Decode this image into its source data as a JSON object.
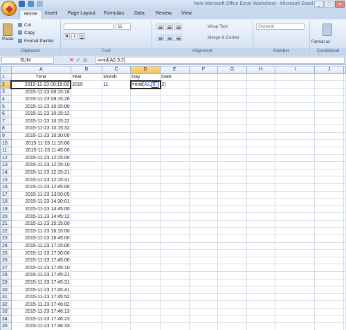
{
  "titlebar": {
    "title": "New Microsoft Office Excel Worksheet - Microsoft Excel",
    "office_button_icon": "office-button-icon",
    "qat_icons": [
      "save-icon",
      "undo-icon",
      "redo-icon"
    ],
    "window_controls": [
      "_",
      "□",
      "×"
    ]
  },
  "ribbon": {
    "tabs": [
      "Home",
      "Insert",
      "Page Layout",
      "Formulas",
      "Data",
      "Review",
      "View"
    ],
    "active_tab": "Home",
    "clipboard": {
      "paste": "Paste",
      "cut": "Cut",
      "copy": "Copy",
      "format_painter": "Format Painter",
      "label": "Clipboard"
    },
    "font": {
      "size": "11",
      "label": "Font",
      "bold": "B",
      "italic": "I",
      "underline": "U"
    },
    "alignment": {
      "wrap_text": "Wrap Text",
      "merge_center": "Merge & Center",
      "label": "Alignment"
    },
    "number": {
      "format": "General",
      "label": "Number"
    },
    "styles": {
      "conditional_formatting": "Conditional Formatting",
      "format_as": "Format as"
    }
  },
  "formula_bar": {
    "name_box": "SUM",
    "cancel": "✕",
    "enter": "✓",
    "fx": "fx",
    "formula": "=mid(A2,9,2)"
  },
  "sheet": {
    "columns": [
      "A",
      "B",
      "C",
      "D",
      "E",
      "F",
      "G",
      "H",
      "I",
      "J"
    ],
    "active_column": "D",
    "active_row": "2",
    "headers": {
      "A": "Time",
      "B": "Year",
      "C": "Month",
      "D": "Day",
      "E": "Date"
    },
    "row2": {
      "year": "2015",
      "month": "11",
      "day_edit_prefix": "=mid(",
      "day_edit_ref": "A2",
      "day_edit_comma": ",",
      "day_edit_arg": "9,",
      "day_edit_suffix": "2)"
    },
    "rows": [
      {
        "n": "1",
        "time": "Time"
      },
      {
        "n": "2",
        "time": "2015-11-23 08:15:00"
      },
      {
        "n": "3",
        "time": "2015-11-23 08:15:16"
      },
      {
        "n": "4",
        "time": "2015-11-23 08:15:26"
      },
      {
        "n": "5",
        "time": "2015-11-23 10:15:00"
      },
      {
        "n": "6",
        "time": "2015-11-23 10:15:12"
      },
      {
        "n": "7",
        "time": "2015-11-23 10:15:22"
      },
      {
        "n": "8",
        "time": "2015-11-23 10:15:32"
      },
      {
        "n": "9",
        "time": "2015-11-23 10:30:00"
      },
      {
        "n": "10",
        "time": "2015-11-23 11:15:00"
      },
      {
        "n": "11",
        "time": "2015-11-23 11:45:00"
      },
      {
        "n": "12",
        "time": "2015-11-23 12:15:00"
      },
      {
        "n": "13",
        "time": "2015-11-23 12:15:10"
      },
      {
        "n": "14",
        "time": "2015-11-23 12:15:21"
      },
      {
        "n": "15",
        "time": "2015-11-23 12:15:31"
      },
      {
        "n": "16",
        "time": "2015-11-23 12:45:00"
      },
      {
        "n": "17",
        "time": "2015-11-23 13:00:05"
      },
      {
        "n": "18",
        "time": "2015-11-23 14:30:01"
      },
      {
        "n": "19",
        "time": "2015-11-23 14:45:00"
      },
      {
        "n": "20",
        "time": "2015-11-23 14:45:12"
      },
      {
        "n": "21",
        "time": "2015-11-23 15:15:00"
      },
      {
        "n": "22",
        "time": "2015-11-23 16:15:00"
      },
      {
        "n": "23",
        "time": "2015-11-23 16:45:00"
      },
      {
        "n": "24",
        "time": "2015-11-23 17:15:00"
      },
      {
        "n": "25",
        "time": "2015-11-23 17:30:00"
      },
      {
        "n": "26",
        "time": "2015-11-23 17:45:00"
      },
      {
        "n": "27",
        "time": "2015-11-23 17:45:10"
      },
      {
        "n": "28",
        "time": "2015-11-23 17:45:21"
      },
      {
        "n": "29",
        "time": "2015-11-23 17:45:31"
      },
      {
        "n": "30",
        "time": "2015-11-23 17:45:41"
      },
      {
        "n": "31",
        "time": "2015-11-23 17:45:52"
      },
      {
        "n": "32",
        "time": "2015-11-23 17:46:02"
      },
      {
        "n": "33",
        "time": "2015-11-23 17:46:13"
      },
      {
        "n": "34",
        "time": "2015-11-23 17:46:23"
      },
      {
        "n": "35",
        "time": "2015-11-23 17:46:33"
      }
    ]
  }
}
